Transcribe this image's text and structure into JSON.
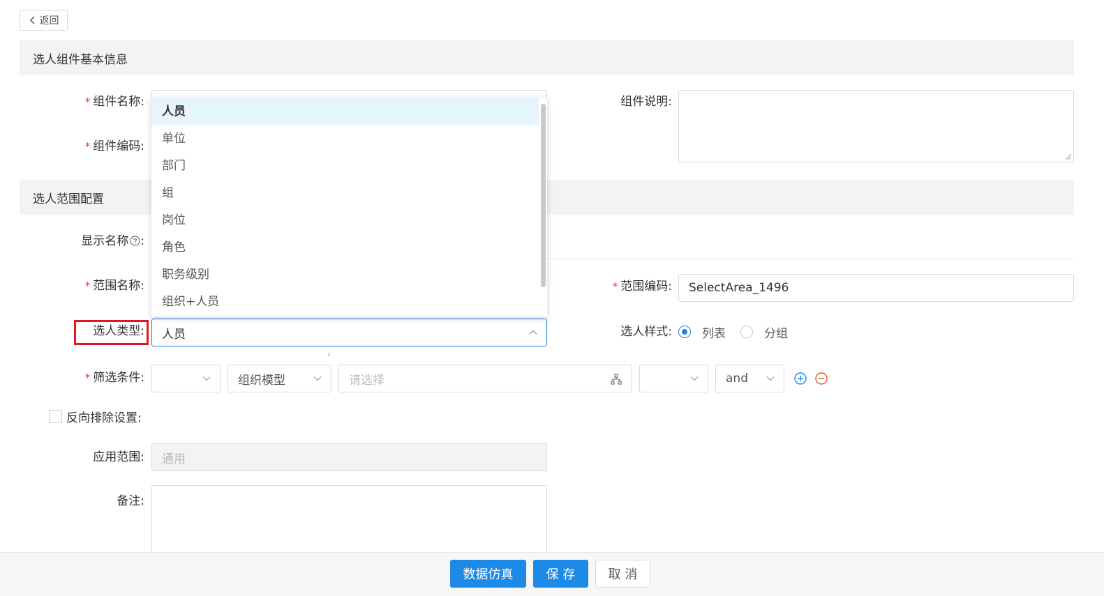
{
  "back_button": {
    "label": "返回"
  },
  "sections": {
    "basic_info": "选人组件基本信息",
    "range_config": "选人范围配置"
  },
  "form": {
    "component_name": {
      "label": "组件名称:",
      "required": true,
      "value": ""
    },
    "component_code": {
      "label": "组件编码:",
      "required": true,
      "value": ""
    },
    "component_desc": {
      "label": "组件说明:",
      "value": ""
    },
    "display_name": {
      "label": "显示名称",
      "colon": ":",
      "value": ""
    },
    "range_name": {
      "label": "范围名称:",
      "required": true,
      "value": ""
    },
    "range_code": {
      "label": "范围编码:",
      "required": true,
      "value": "SelectArea_1496"
    },
    "select_type": {
      "label": "选人类型:",
      "value": "人员"
    },
    "select_style": {
      "label": "选人样式:",
      "options": [
        "列表",
        "分组"
      ],
      "selected": "列表"
    },
    "filter": {
      "label": "筛选条件:",
      "required": true,
      "field1": "",
      "field2": "组织模型",
      "field3_placeholder": "请选择",
      "field4": "",
      "field5": "and"
    },
    "reverse_exclude": {
      "label": "反向排除设置:",
      "checked": false
    },
    "apply_scope": {
      "label": "应用范围:",
      "value": "通用"
    },
    "remark": {
      "label": "备注:",
      "value": ""
    }
  },
  "dropdown": {
    "items": [
      "人员",
      "单位",
      "部门",
      "组",
      "岗位",
      "角色",
      "职务级别",
      "组织+人员"
    ],
    "selected": "人员"
  },
  "footer": {
    "simulate": "数据仿真",
    "save": "保 存",
    "cancel": "取 消"
  },
  "colors": {
    "primary": "#1c8ae6",
    "required": "#e6423b",
    "highlight_box": "#e2161d",
    "remove_icon": "#e8542a"
  }
}
